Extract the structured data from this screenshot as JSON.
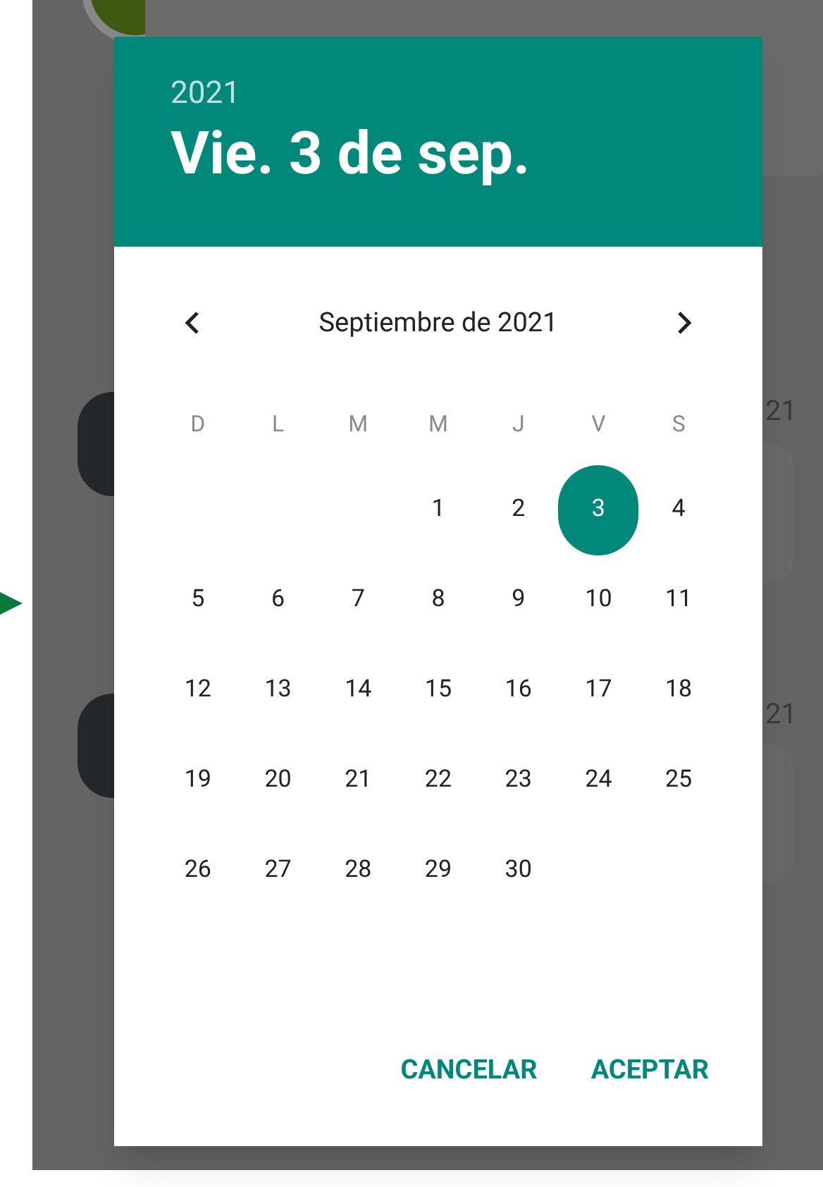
{
  "background": {
    "date_fragments": [
      "21",
      "21"
    ]
  },
  "dialog": {
    "year": "2021",
    "date": "Vie. 3 de sep.",
    "month": "Septiembre de 2021",
    "weekdays": [
      "D",
      "L",
      "M",
      "M",
      "J",
      "V",
      "S"
    ],
    "weeks": [
      [
        {
          "label": "1",
          "selected": false
        },
        {
          "label": "2",
          "selected": false
        },
        {
          "label": "3",
          "selected": true
        },
        {
          "label": "4",
          "selected": false
        }
      ],
      [
        {
          "label": "5",
          "selected": false
        },
        {
          "label": "6",
          "selected": false
        },
        {
          "label": "7",
          "selected": false
        },
        {
          "label": "8",
          "selected": false
        },
        {
          "label": "9",
          "selected": false
        },
        {
          "label": "10",
          "selected": false
        },
        {
          "label": "11",
          "selected": false
        }
      ],
      [
        {
          "label": "12",
          "selected": false
        },
        {
          "label": "13",
          "selected": false
        },
        {
          "label": "14",
          "selected": false
        },
        {
          "label": "15",
          "selected": false
        },
        {
          "label": "16",
          "selected": false
        },
        {
          "label": "17",
          "selected": false
        },
        {
          "label": "18",
          "selected": false
        }
      ],
      [
        {
          "label": "19",
          "selected": false
        },
        {
          "label": "20",
          "selected": false
        },
        {
          "label": "21",
          "selected": false
        },
        {
          "label": "22",
          "selected": false
        },
        {
          "label": "23",
          "selected": false
        },
        {
          "label": "24",
          "selected": false
        },
        {
          "label": "25",
          "selected": false
        }
      ],
      [
        {
          "label": "26",
          "selected": false
        },
        {
          "label": "27",
          "selected": false
        },
        {
          "label": "28",
          "selected": false
        },
        {
          "label": "29",
          "selected": false
        },
        {
          "label": "30",
          "selected": false
        }
      ]
    ],
    "buttons": [
      "CANCELAR",
      "ACEPTAR"
    ]
  }
}
